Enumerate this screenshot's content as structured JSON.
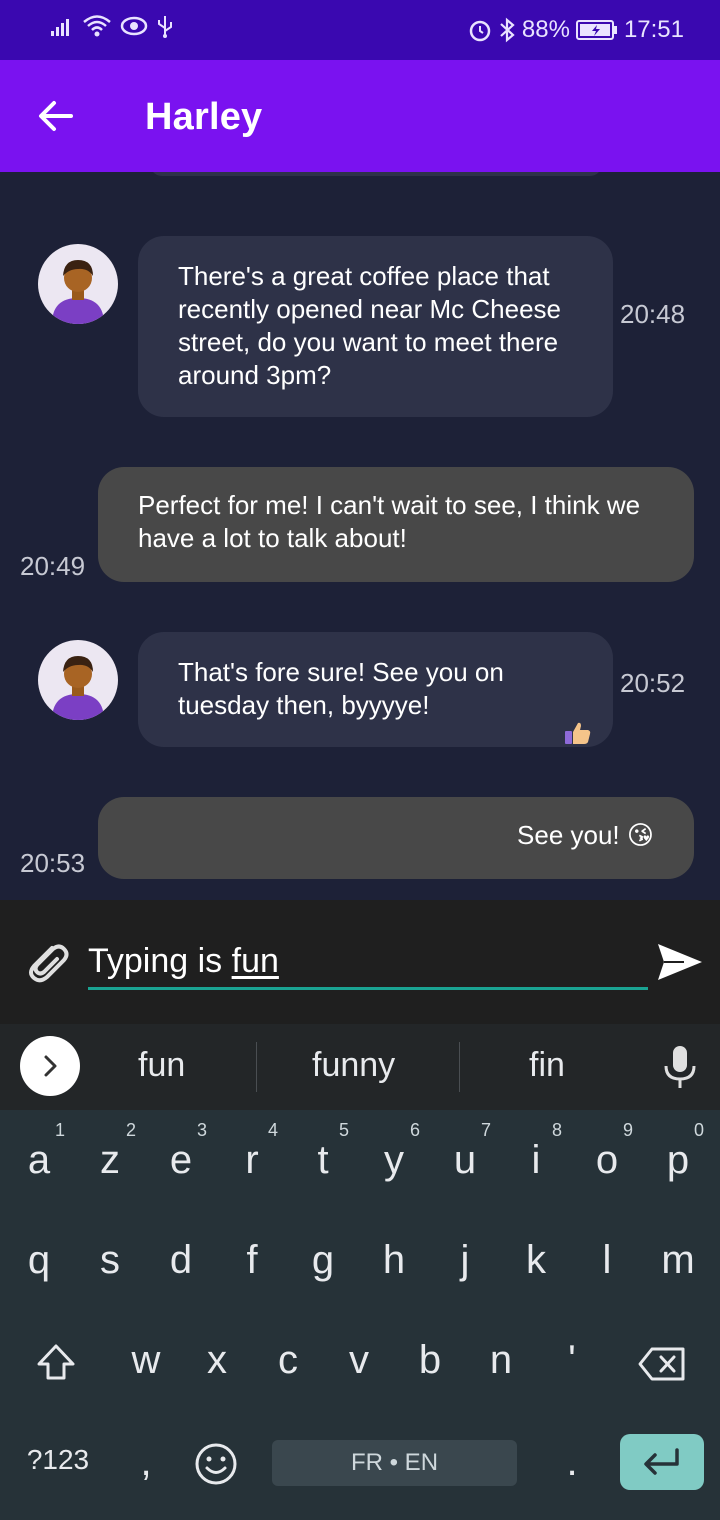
{
  "status_bar": {
    "battery_percent": "88%",
    "time": "17:51"
  },
  "header": {
    "contact_name": "Harley"
  },
  "messages": [
    {
      "direction": "in",
      "text": "There's a great coffee place that recently opened near Mc Cheese street, do you want to meet there around 3pm?",
      "time": "20:48"
    },
    {
      "direction": "out",
      "text": "Perfect for me! I can't wait to see, I think we have a lot to talk about!",
      "time": "20:49"
    },
    {
      "direction": "in",
      "text": "That's fore sure! See you on tuesday then, byyyye!",
      "time": "20:52",
      "reaction": "thumbs-up-icon"
    },
    {
      "direction": "out",
      "text": "See you! 😘",
      "time": "20:53"
    }
  ],
  "composer": {
    "value_prefix": "Typing is ",
    "value_word": "fun"
  },
  "suggestions": [
    "fun",
    "funny",
    "fin"
  ],
  "keyboard": {
    "row1": [
      "a",
      "z",
      "e",
      "r",
      "t",
      "y",
      "u",
      "i",
      "o",
      "p"
    ],
    "row1_hints": [
      "1",
      "2",
      "3",
      "4",
      "5",
      "6",
      "7",
      "8",
      "9",
      "0"
    ],
    "row2": [
      "q",
      "s",
      "d",
      "f",
      "g",
      "h",
      "j",
      "k",
      "l",
      "m"
    ],
    "row3": [
      "w",
      "x",
      "c",
      "v",
      "b",
      "n",
      "'"
    ],
    "symbols_label": "?123",
    "comma": ",",
    "period": ".",
    "space_label": "FR • EN"
  },
  "colors": {
    "status_bar": "#3a08b0",
    "app_bar": "#7a12f0",
    "background": "#1d2137",
    "incoming_bubble": "#2e3248",
    "outgoing_bubble": "#484848",
    "input_underline": "#1aa392",
    "enter_key": "#80cbc4"
  }
}
